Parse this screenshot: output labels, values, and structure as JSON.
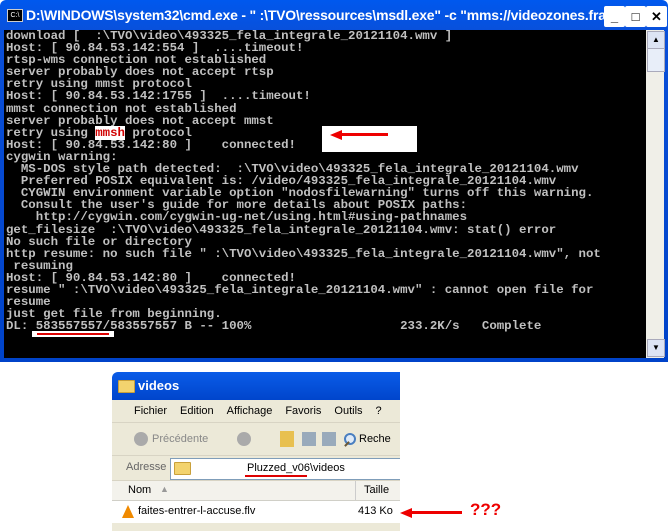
{
  "cmd": {
    "title": "D:\\WINDOWS\\system32\\cmd.exe - \"  :\\TVO\\ressources\\msdl.exe\" -c \"mms://videozones.fra...",
    "icon": "cmd-icon",
    "lines": [
      "download [  :\\TVO\\video\\493325_fela_integrale_20121104.wmv ]",
      "Host: [ 90.84.53.142:554 ]  ....timeout!",
      "rtsp-wms connection not established",
      "server probably does not accept rtsp",
      "retry using mmst protocol",
      "Host: [ 90.84.53.142:1755 ]  ....timeout!",
      "mmst connection not established",
      "server probably does not accept mmst"
    ],
    "highlight_line": {
      "before": "retry using ",
      "highlight": "mmsh",
      "after": " protocol"
    },
    "lines2": [
      "Host: [ 90.84.53.142:80 ]    connected!",
      "cygwin warning:",
      "  MS-DOS style path detected:  :\\TVO\\video\\493325_fela_integrale_20121104.wmv",
      "  Preferred POSIX equivalent is: /video/493325_fela_integrale_20121104.wmv",
      "  CYGWIN environment variable option \"nodosfilewarning\" turns off this warning.",
      "  Consult the user's guide for more details about POSIX paths:",
      "    http://cygwin.com/cygwin-ug-net/using.html#using-pathnames",
      "get_filesize  :\\TVO\\video\\493325_fela_integrale_20121104.wmv: stat() error",
      "No such file or directory",
      "http resume: no such file \" :\\TVO\\video\\493325_fela_integrale_20121104.wmv\", not",
      " resuming",
      "Host: [ 90.84.53.142:80 ]    connected!",
      "resume \" :\\TVO\\video\\493325_fela_integrale_20121104.wmv\" : cannot open file for",
      "resume",
      "just get file from beginning.",
      "DL: 583557557/583557557 B -- 100%                    233.2K/s   Complete"
    ]
  },
  "explorer": {
    "title": "videos",
    "menu": [
      "Fichier",
      "Edition",
      "Affichage",
      "Favoris",
      "Outils",
      "?"
    ],
    "back_label": "Précédente",
    "search_label": "Reche",
    "address_label": "Adresse",
    "address_value": "Pluzzed_v06\\videos",
    "columns": [
      "Nom",
      "Taille"
    ],
    "files": [
      {
        "name": "faites-entrer-l-accuse.flv",
        "size": "413 Ko",
        "icon": "vlc-cone-icon"
      }
    ]
  },
  "annotation": {
    "text": "???",
    "color": "#e00000"
  }
}
